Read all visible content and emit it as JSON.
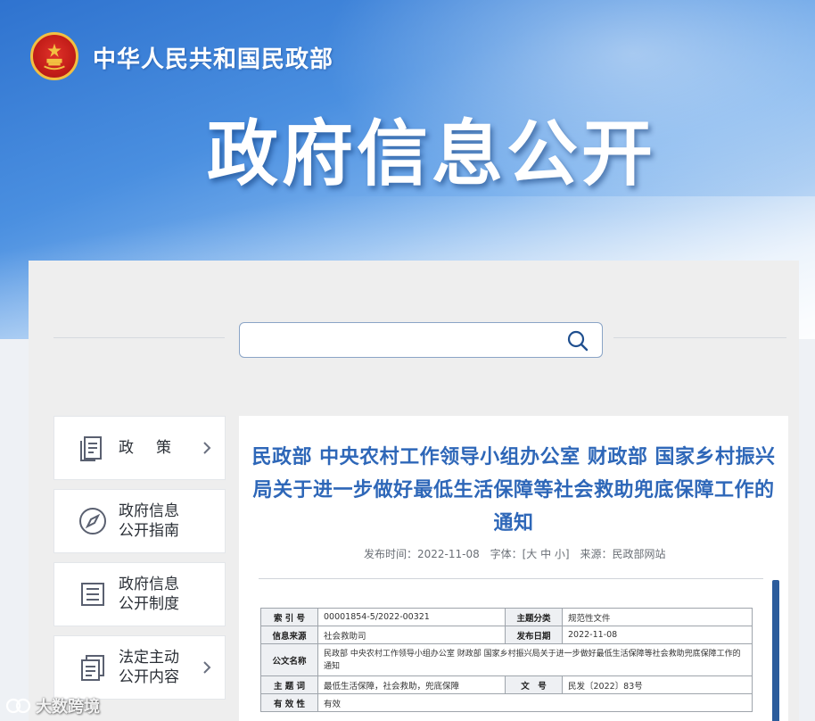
{
  "header": {
    "ministry_name": "中华人民共和国民政部",
    "section_title": "政府信息公开"
  },
  "search": {
    "value": "",
    "placeholder": ""
  },
  "sidebar": {
    "items": [
      {
        "label": "政　策",
        "icon": "policy-document-icon",
        "has_arrow": true
      },
      {
        "label_line1": "政府信息",
        "label_line2": "公开指南",
        "icon": "compass-icon",
        "has_arrow": false
      },
      {
        "label_line1": "政府信息",
        "label_line2": "公开制度",
        "icon": "regulation-list-icon",
        "has_arrow": false
      },
      {
        "label_line1": "法定主动",
        "label_line2": "公开内容",
        "icon": "stacked-documents-icon",
        "has_arrow": true
      }
    ]
  },
  "article": {
    "title": "民政部 中央农村工作领导小组办公室 财政部 国家乡村振兴局关于进一步做好最低生活保障等社会救助兜底保障工作的通知",
    "meta": {
      "published_label": "发布时间：",
      "published_date": "2022-11-08",
      "font_label": "字体：",
      "font_sizes": "[大 中 小]",
      "source_label": "来源：",
      "source": "民政部网站"
    },
    "info_table": {
      "index_label": "索 引 号",
      "index_value": "00001854-5/2022-00321",
      "topic_label": "主题分类",
      "topic_value": "规范性文件",
      "origin_label": "信息来源",
      "origin_value": "社会救助司",
      "date_label": "发布日期",
      "date_value": "2022-11-08",
      "doc_name_label": "公文名称",
      "doc_name_value": "民政部 中央农村工作领导小组办公室 财政部 国家乡村振兴局关于进一步做好最低生活保障等社会救助兜底保障工作的通知",
      "keywords_label": "主 题 词",
      "keywords_value": "最低生活保障，社会救助，兜底保障",
      "doc_no_label": "文　号",
      "doc_no_value": "民发〔2022〕83号",
      "validity_label": "有 效 性",
      "validity_value": "有效"
    }
  },
  "watermark": {
    "text": "大数跨境"
  },
  "colors": {
    "accent_blue": "#2e67b8",
    "banner_blue": "#3b7ed6",
    "emblem_red": "#c21d18",
    "emblem_gold": "#f2c041"
  }
}
